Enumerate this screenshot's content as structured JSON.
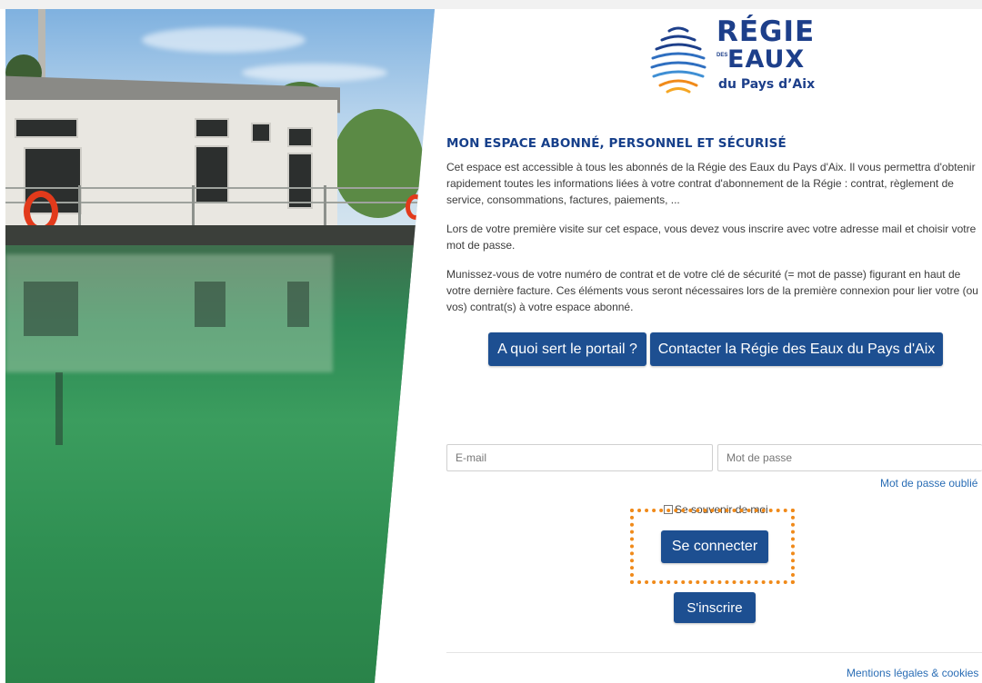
{
  "brand": {
    "line1": "RÉGIE",
    "des": "DES",
    "line2": "EAUX",
    "line3": "du Pays d’Aix"
  },
  "intro": {
    "title": "MON ESPACE ABONNÉ, PERSONNEL ET SÉCURISÉ",
    "p1": "Cet espace est accessible à tous les abonnés de la Régie des Eaux du Pays d'Aix. Il vous permettra d'obtenir rapidement toutes les informations liées à votre contrat d'abonnement de la Régie : contrat, règlement de service, consommations, factures, paiements, ...",
    "p2": "Lors de votre première visite sur cet espace, vous devez vous inscrire avec votre adresse mail et choisir votre mot de passe.",
    "p3": "Munissez-vous de votre numéro de contrat et de votre clé de sécurité (= mot de passe) figurant en haut de votre dernière facture. Ces éléments vous seront nécessaires lors de la première connexion pour lier votre (ou vos) contrat(s) à votre espace abonné."
  },
  "buttons": {
    "about": "A quoi sert le portail ?",
    "contact": "Contacter la Régie des Eaux du Pays d'Aix",
    "login": "Se connecter",
    "signup": "S'inscrire"
  },
  "form": {
    "email_placeholder": "E-mail",
    "email_value": "",
    "password_placeholder": "Mot de passe",
    "password_value": "",
    "forgot": "Mot de passe oublié",
    "remember": "Se souvenir de moi",
    "remember_checked": false
  },
  "footer": {
    "legal": "Mentions légales & cookies"
  },
  "colors": {
    "primary": "#1d4f91",
    "heading": "#163f8a",
    "link": "#2a6db5",
    "highlight": "#f08a1a"
  }
}
